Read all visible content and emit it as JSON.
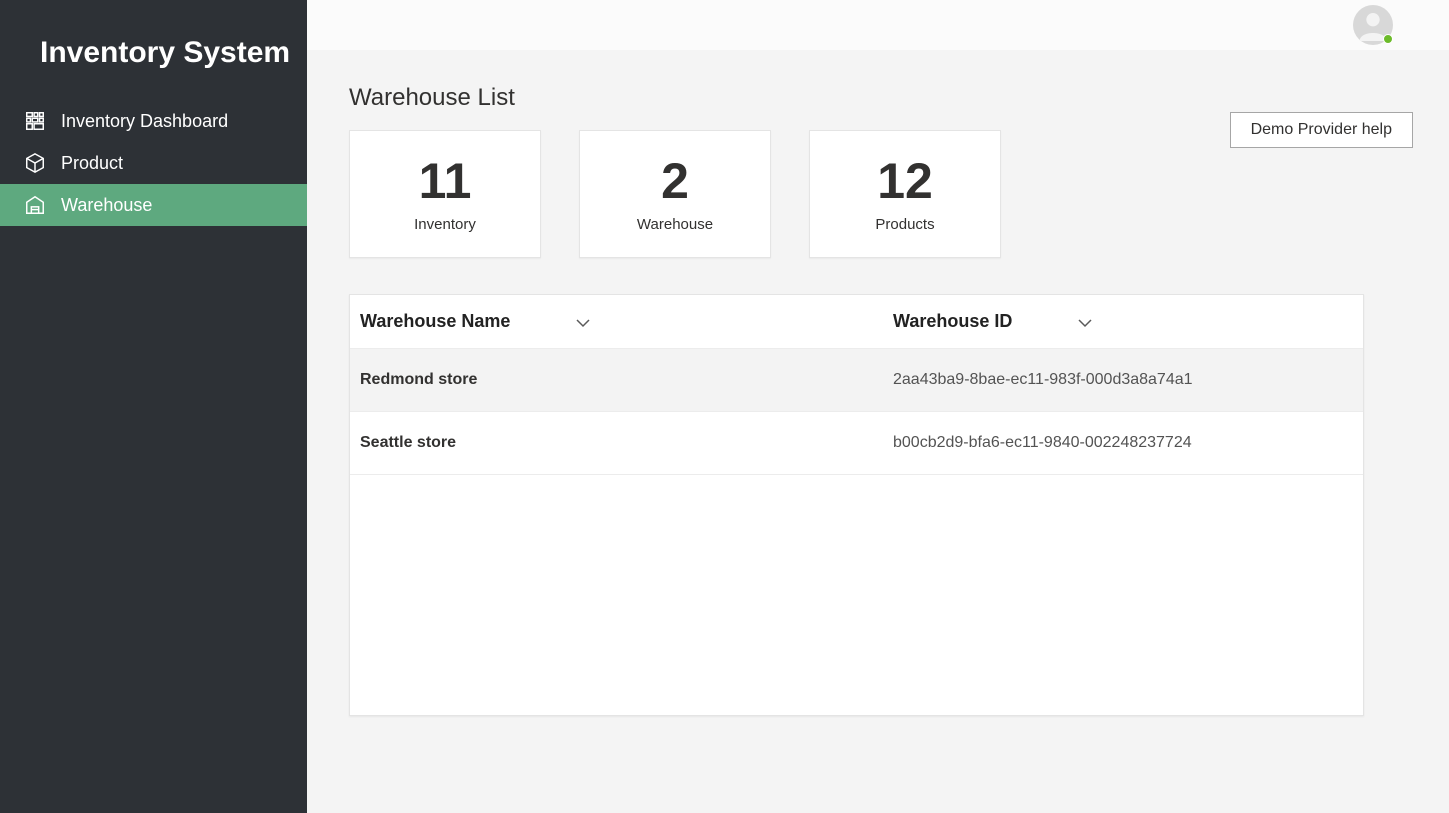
{
  "sidebar": {
    "title": "Inventory System",
    "items": [
      {
        "label": "Inventory Dashboard"
      },
      {
        "label": "Product"
      },
      {
        "label": "Warehouse"
      }
    ]
  },
  "page": {
    "title": "Warehouse List",
    "help_button": "Demo Provider help"
  },
  "stats": [
    {
      "value": "11",
      "label": "Inventory"
    },
    {
      "value": "2",
      "label": "Warehouse"
    },
    {
      "value": "12",
      "label": "Products"
    }
  ],
  "table": {
    "columns": [
      {
        "label": "Warehouse Name"
      },
      {
        "label": "Warehouse ID"
      }
    ],
    "rows": [
      {
        "name": "Redmond store",
        "id": "2aa43ba9-8bae-ec11-983f-000d3a8a74a1"
      },
      {
        "name": "Seattle store",
        "id": "b00cb2d9-bfa6-ec11-9840-002248237724"
      }
    ]
  }
}
